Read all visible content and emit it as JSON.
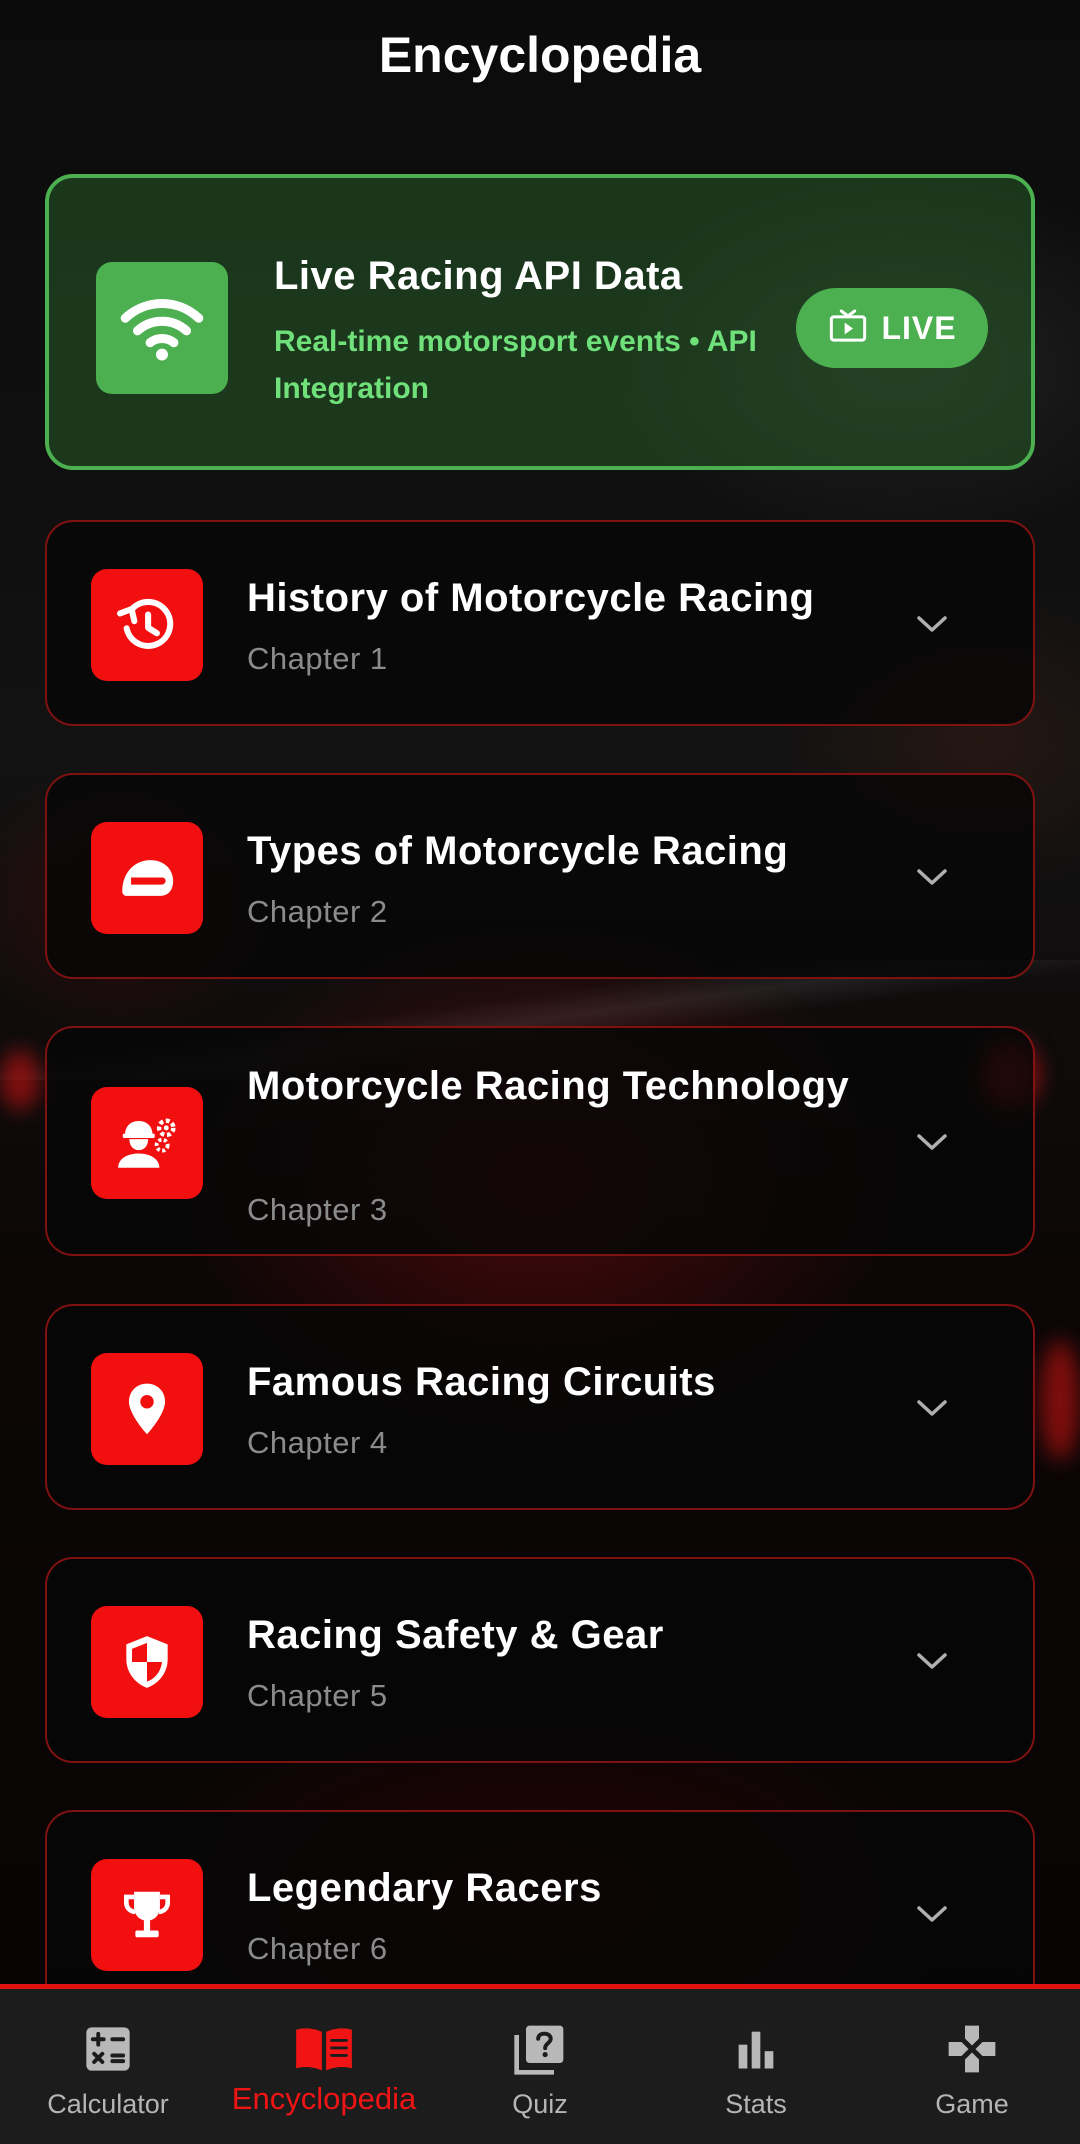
{
  "header": {
    "title": "Encyclopedia"
  },
  "live_card": {
    "icon": "wifi-icon",
    "title": "Live Racing API Data",
    "subtitle": "Real-time motorsport events • API Integration",
    "badge_icon": "live-tv-icon",
    "badge_label": "LIVE",
    "accent_color": "#4caf50"
  },
  "chapters": [
    {
      "title": "History of Motorcycle Racing",
      "subtitle": "Chapter 1",
      "icon": "history-icon"
    },
    {
      "title": "Types of Motorcycle Racing",
      "subtitle": "Chapter 2",
      "icon": "helmet-icon"
    },
    {
      "title": "Motorcycle Racing Technology",
      "subtitle": "Chapter 3",
      "icon": "engineering-icon"
    },
    {
      "title": "Famous Racing Circuits",
      "subtitle": "Chapter 4",
      "icon": "location-pin-icon"
    },
    {
      "title": "Racing Safety & Gear",
      "subtitle": "Chapter 5",
      "icon": "shield-icon"
    },
    {
      "title": "Legendary Racers",
      "subtitle": "Chapter 6",
      "icon": "trophy-icon"
    }
  ],
  "bottom_nav": {
    "items": [
      {
        "label": "Calculator",
        "icon": "calculator-icon",
        "active": false
      },
      {
        "label": "Encyclopedia",
        "icon": "book-icon",
        "active": true
      },
      {
        "label": "Quiz",
        "icon": "quiz-icon",
        "active": false
      },
      {
        "label": "Stats",
        "icon": "bar-chart-icon",
        "active": false
      },
      {
        "label": "Game",
        "icon": "gamepad-icon",
        "active": false
      }
    ]
  },
  "colors": {
    "accent_red": "#f20f0f",
    "accent_green": "#4caf50",
    "subtitle_green": "#6fe07a"
  }
}
